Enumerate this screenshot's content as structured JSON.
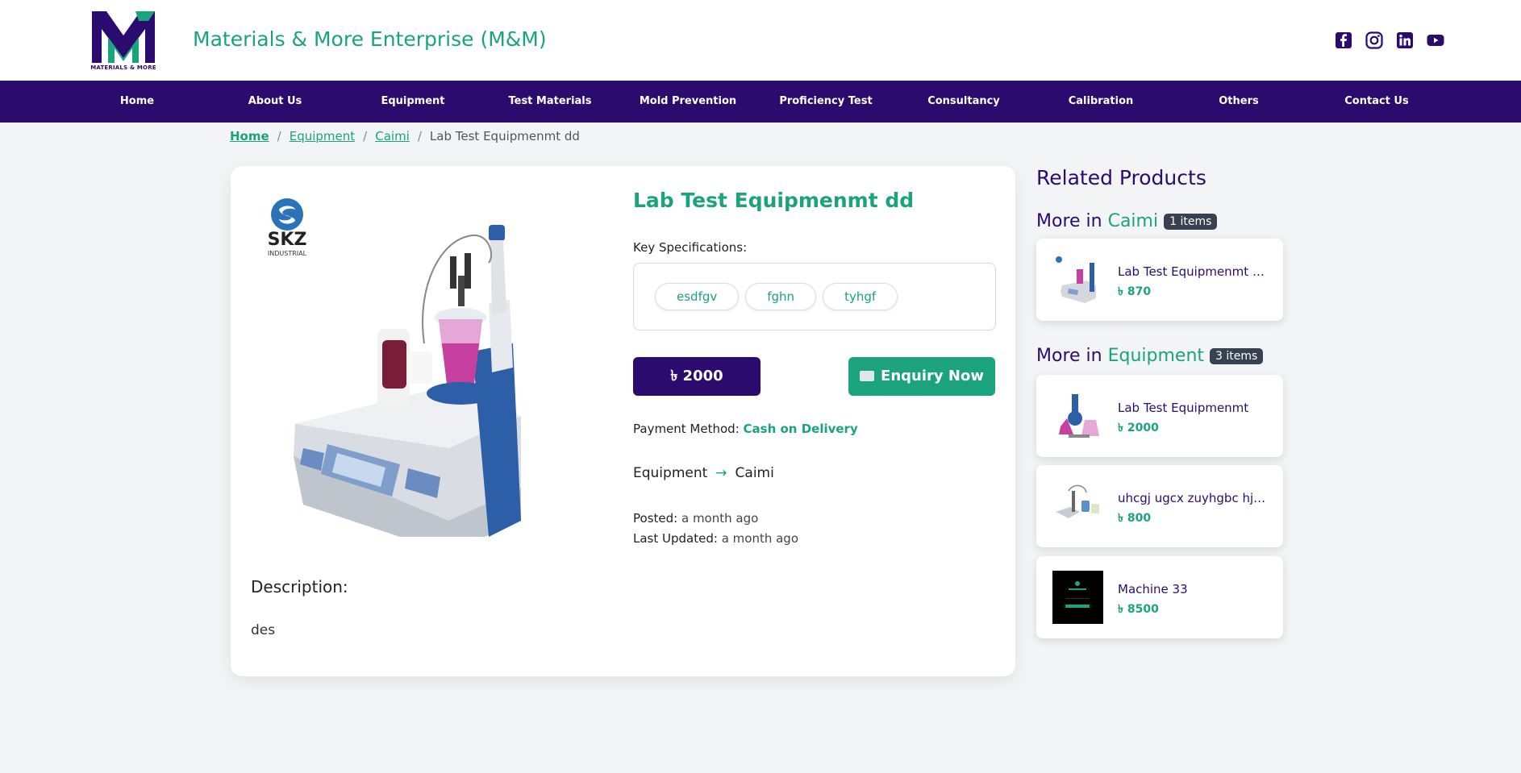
{
  "header": {
    "logo_text": "MATERIALS & MORE",
    "brand": "Materials & More Enterprise (M&M)",
    "socials": [
      "facebook-icon",
      "instagram-icon",
      "linkedin-icon",
      "youtube-icon"
    ]
  },
  "nav": {
    "items": [
      {
        "label": "Home"
      },
      {
        "label": "About Us"
      },
      {
        "label": "Equipment"
      },
      {
        "label": "Test Materials"
      },
      {
        "label": "Mold Prevention"
      },
      {
        "label": "Proficiency Test"
      },
      {
        "label": "Consultancy"
      },
      {
        "label": "Calibration"
      },
      {
        "label": "Others"
      },
      {
        "label": "Contact Us"
      }
    ]
  },
  "breadcrumb": {
    "home": "Home",
    "category": "Equipment",
    "subcategory": "Caimi",
    "current": "Lab Test Equipmenmt dd",
    "sep": "/"
  },
  "product": {
    "title": "Lab Test Equipmenmt dd",
    "spec_label": "Key Specifications:",
    "specs": [
      "esdfgv",
      "fghn",
      "tyhgf"
    ],
    "price": "৳ 2000",
    "enquiry": "Enquiry Now",
    "payment_label": "Payment Method:",
    "payment_value": "Cash on Delivery",
    "category": "Equipment",
    "category_arrow": "→",
    "subcategory": "Caimi",
    "posted_label": "Posted:",
    "posted_value": "a month ago",
    "updated_label": "Last Updated:",
    "updated_value": "a month ago",
    "description_label": "Description:",
    "description": "des",
    "image_brand": "SKZ",
    "image_brand_sub": "INDUSTRIAL"
  },
  "related": {
    "title": "Related Products",
    "group1": {
      "prefix": "More in",
      "name": "Caimi",
      "badge": "1 items",
      "items": [
        {
          "name": "Lab Test Equipmenmt Ma...",
          "price": "৳ 870"
        }
      ]
    },
    "group2": {
      "prefix": "More in",
      "name": "Equipment",
      "badge": "3 items",
      "items": [
        {
          "name": "Lab Test Equipmenmt",
          "price": "৳ 2000"
        },
        {
          "name": "uhcgj ugcx zuyhgbc hjbn...",
          "price": "৳ 800"
        },
        {
          "name": "Machine 33",
          "price": "৳ 8500"
        }
      ]
    }
  },
  "colors": {
    "brand_purple": "#2c0b6e",
    "brand_green": "#1aa37c"
  }
}
